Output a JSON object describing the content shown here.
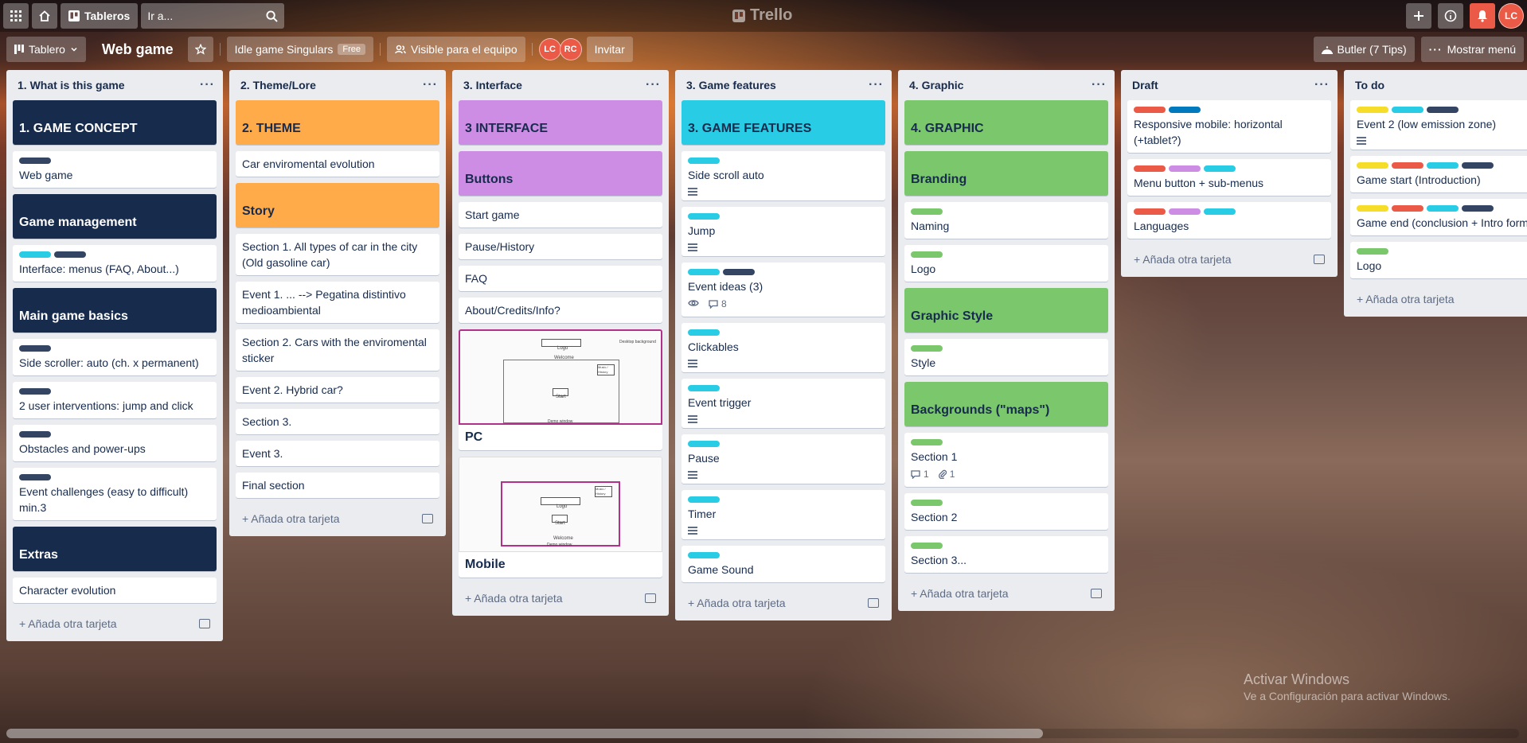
{
  "topbar": {
    "boards_label": "Tableros",
    "search_placeholder": "Ir a...",
    "logo_text": "Trello",
    "user_initials": "LC"
  },
  "boardbar": {
    "view_label": "Tablero",
    "board_title": "Web game",
    "workspace_label": "Idle game Singulars",
    "workspace_badge": "Free",
    "visibility_label": "Visible para el equipo",
    "members": [
      "LC",
      "RC"
    ],
    "invite_label": "Invitar",
    "butler_label": "Butler (7 Tips)",
    "menu_label": "Mostrar menú"
  },
  "colors": {
    "navy": "#172b4d",
    "orange": "#ffab4a",
    "purple": "#cd8de5",
    "cyan": "#29cce5",
    "green": "#7bc86c",
    "red": "#eb5a46",
    "blue": "#0079bf",
    "yellow": "#f5dd29"
  },
  "add_card_label": "Añada otra tarjeta",
  "lists": [
    {
      "title": "1. What is this game",
      "cards": [
        {
          "type": "head",
          "color": "#172b4d",
          "text": "1. GAME CONCEPT"
        },
        {
          "type": "card",
          "labels": [
            "#344563"
          ],
          "text": "Web game"
        },
        {
          "type": "head",
          "color": "#172b4d",
          "text": "Game management"
        },
        {
          "type": "card",
          "labels": [
            "#29cce5",
            "#344563"
          ],
          "text": "Interface: menus (FAQ, About...)"
        },
        {
          "type": "head",
          "color": "#172b4d",
          "text": "Main game basics"
        },
        {
          "type": "card",
          "labels": [
            "#344563"
          ],
          "text": "Side scroller: auto (ch. x permanent)"
        },
        {
          "type": "card",
          "labels": [
            "#344563"
          ],
          "text": "2 user interventions: jump and click"
        },
        {
          "type": "card",
          "labels": [
            "#344563"
          ],
          "text": "Obstacles and power-ups"
        },
        {
          "type": "card",
          "labels": [
            "#344563"
          ],
          "text": "Event challenges (easy to difficult) min.3"
        },
        {
          "type": "head",
          "color": "#172b4d",
          "text": "Extras"
        },
        {
          "type": "card",
          "labels": [],
          "text": "Character evolution"
        }
      ]
    },
    {
      "title": "2. Theme/Lore",
      "cards": [
        {
          "type": "head",
          "color": "#ffab4a",
          "text": "2. THEME",
          "dark": true
        },
        {
          "type": "card",
          "labels": [],
          "text": "Car enviromental evolution"
        },
        {
          "type": "head",
          "color": "#ffab4a",
          "text": "Story",
          "dark": true
        },
        {
          "type": "card",
          "labels": [],
          "text": "Section 1. All types of car in the city (Old gasoline car)"
        },
        {
          "type": "card",
          "labels": [],
          "text": "Event 1. ... --> Pegatina distintivo medioambiental"
        },
        {
          "type": "card",
          "labels": [],
          "text": "Section 2. Cars with the enviromental sticker"
        },
        {
          "type": "card",
          "labels": [],
          "text": "Event 2. Hybrid car?"
        },
        {
          "type": "card",
          "labels": [],
          "text": "Section 3."
        },
        {
          "type": "card",
          "labels": [],
          "text": "Event 3."
        },
        {
          "type": "card",
          "labels": [],
          "text": "Final section"
        }
      ]
    },
    {
      "title": "3. Interface",
      "cards": [
        {
          "type": "head",
          "color": "#cd8de5",
          "text": "3 INTERFACE",
          "dark": true
        },
        {
          "type": "head",
          "color": "#cd8de5",
          "text": "Buttons",
          "dark": true
        },
        {
          "type": "card",
          "labels": [],
          "text": "Start game"
        },
        {
          "type": "card",
          "labels": [],
          "text": "Pause/History"
        },
        {
          "type": "card",
          "labels": [],
          "text": "FAQ"
        },
        {
          "type": "card",
          "labels": [],
          "text": "About/Credits/Info?"
        },
        {
          "type": "wire",
          "text": "PC",
          "wf": {
            "logo": "Logo",
            "welcome": "Welcome",
            "start": "Start",
            "menu": "Music / History",
            "footer": "Demo window",
            "caption": "Desktop background"
          }
        },
        {
          "type": "wire",
          "text": "Mobile",
          "wf": {
            "logo": "Logo",
            "welcome": "Welcome",
            "start": "Start",
            "menu": "Music / History",
            "footer": "Demo window",
            "caption": ""
          }
        }
      ]
    },
    {
      "title": "3. Game features",
      "cards": [
        {
          "type": "head",
          "color": "#29cce5",
          "text": "3. GAME FEATURES",
          "dark": true
        },
        {
          "type": "card",
          "labels": [
            "#29cce5"
          ],
          "text": "Side scroll auto",
          "desc": true
        },
        {
          "type": "card",
          "labels": [
            "#29cce5"
          ],
          "text": "Jump",
          "desc": true
        },
        {
          "type": "card",
          "labels": [
            "#29cce5",
            "#344563"
          ],
          "text": "Event ideas (3)",
          "watch": true,
          "comments": "8"
        },
        {
          "type": "card",
          "labels": [
            "#29cce5"
          ],
          "text": "Clickables",
          "desc": true
        },
        {
          "type": "card",
          "labels": [
            "#29cce5"
          ],
          "text": "Event trigger",
          "desc": true
        },
        {
          "type": "card",
          "labels": [
            "#29cce5"
          ],
          "text": "Pause",
          "desc": true
        },
        {
          "type": "card",
          "labels": [
            "#29cce5"
          ],
          "text": "Timer",
          "desc": true
        },
        {
          "type": "card",
          "labels": [
            "#29cce5"
          ],
          "text": "Game Sound"
        }
      ]
    },
    {
      "title": "4. Graphic",
      "cards": [
        {
          "type": "head",
          "color": "#7bc86c",
          "text": "4. GRAPHIC",
          "dark": true
        },
        {
          "type": "head",
          "color": "#7bc86c",
          "text": "Branding",
          "dark": true
        },
        {
          "type": "card",
          "labels": [
            "#7bc86c"
          ],
          "text": "Naming"
        },
        {
          "type": "card",
          "labels": [
            "#7bc86c"
          ],
          "text": "Logo"
        },
        {
          "type": "head",
          "color": "#7bc86c",
          "text": "Graphic Style",
          "dark": true
        },
        {
          "type": "card",
          "labels": [
            "#7bc86c"
          ],
          "text": "Style"
        },
        {
          "type": "head",
          "color": "#7bc86c",
          "text": "Backgrounds (\"maps\")",
          "dark": true
        },
        {
          "type": "card",
          "labels": [
            "#7bc86c"
          ],
          "text": "Section 1",
          "comments": "1",
          "attachments": "1"
        },
        {
          "type": "card",
          "labels": [
            "#7bc86c"
          ],
          "text": "Section 2"
        },
        {
          "type": "card",
          "labels": [
            "#7bc86c"
          ],
          "text": "Section 3..."
        }
      ]
    },
    {
      "title": "Draft",
      "cards": [
        {
          "type": "card",
          "labels": [
            "#eb5a46",
            "#0079bf"
          ],
          "text": "Responsive mobile: horizontal (+tablet?)"
        },
        {
          "type": "card",
          "labels": [
            "#eb5a46",
            "#cd8de5",
            "#29cce5"
          ],
          "text": "Menu button + sub-menus"
        },
        {
          "type": "card",
          "labels": [
            "#eb5a46",
            "#cd8de5",
            "#29cce5"
          ],
          "text": "Languages"
        }
      ]
    },
    {
      "title": "To do",
      "cards": [
        {
          "type": "card",
          "labels": [
            "#f5dd29",
            "#29cce5",
            "#344563"
          ],
          "text": "Event 2 (low emission zone)",
          "desc": true
        },
        {
          "type": "card",
          "labels": [
            "#f5dd29",
            "#eb5a46",
            "#29cce5",
            "#344563"
          ],
          "text": "Game start (Introduction)"
        },
        {
          "type": "card",
          "labels": [
            "#f5dd29",
            "#eb5a46",
            "#29cce5",
            "#344563"
          ],
          "text": "Game end (conclusion + Intro form)"
        },
        {
          "type": "card",
          "labels": [
            "#7bc86c"
          ],
          "text": "Logo"
        }
      ]
    }
  ],
  "watermark": {
    "line1": "Activar Windows",
    "line2": "Ve a Configuración para activar Windows."
  }
}
